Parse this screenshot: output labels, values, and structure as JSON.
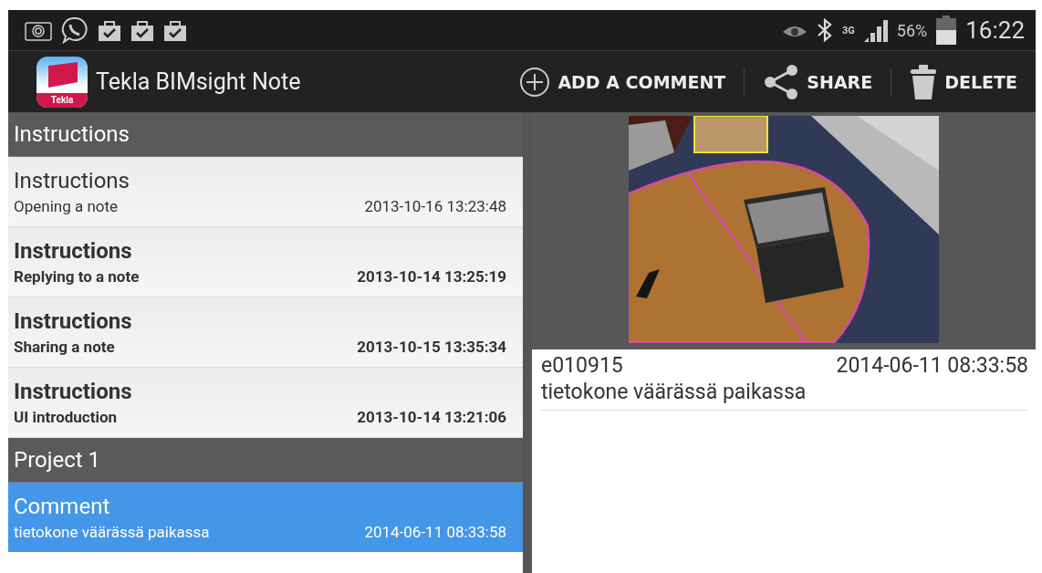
{
  "status_bar": {
    "battery": "56%",
    "network": "3G",
    "time": "16:22"
  },
  "action_bar": {
    "app_logo_text": "Tekla",
    "title": "Tekla BIMsight Note",
    "actions": [
      {
        "kind": "add",
        "label": "ADD A COMMENT"
      },
      {
        "kind": "share",
        "label": "SHARE"
      },
      {
        "kind": "delete",
        "label": "DELETE"
      }
    ]
  },
  "sections": [
    {
      "title": "Instructions",
      "notes": [
        {
          "title": "Instructions",
          "subtitle": "Opening a note",
          "date": "2013-10-16 13:23:48",
          "unread": false,
          "selected": false
        },
        {
          "title": "Instructions",
          "subtitle": "Replying to a note",
          "date": "2013-10-14 13:25:19",
          "unread": true,
          "selected": false
        },
        {
          "title": "Instructions",
          "subtitle": "Sharing a note",
          "date": "2013-10-15 13:35:34",
          "unread": true,
          "selected": false
        },
        {
          "title": "Instructions",
          "subtitle": "UI introduction",
          "date": "2013-10-14 13:21:06",
          "unread": true,
          "selected": false
        }
      ]
    },
    {
      "title": "Project 1",
      "notes": [
        {
          "title": "Comment",
          "subtitle": "tietokone väärässä paikassa",
          "date": "2014-06-11 08:33:58",
          "unread": false,
          "selected": true
        }
      ]
    }
  ],
  "detail": {
    "comments": [
      {
        "author": "e010915",
        "date": "2014-06-11 08:33:58",
        "text": "tietokone väärässä paikassa"
      }
    ]
  }
}
